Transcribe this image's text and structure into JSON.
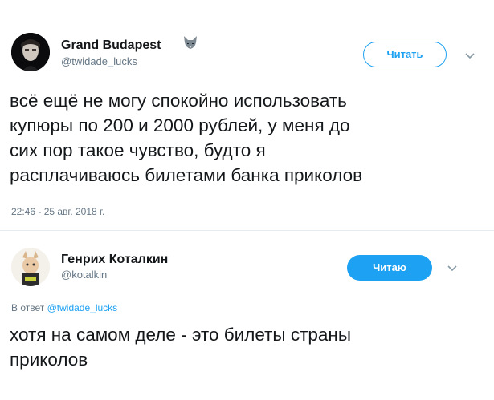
{
  "tweets": [
    {
      "author": {
        "name": "Grand Budapest",
        "handle": "@twidade_lucks",
        "emoji": "wolf-icon"
      },
      "follow_label": "Читать",
      "text_lines": [
        "всё ещё не могу спокойно использовать",
        "купюры по 200 и 2000 рублей, у меня до",
        "сих пор такое чувство, будто я",
        "расплачиваюсь билетами банка приколов"
      ],
      "timestamp": "22:46 - 25 авг. 2018 г."
    },
    {
      "author": {
        "name": "Генрих Коталкин",
        "handle": "@kotalkin"
      },
      "follow_label": "Читаю",
      "reply_prefix": "В ответ",
      "reply_handle": "@twidade_lucks",
      "text_lines": [
        "хотя на самом деле - это билеты страны",
        "приколов"
      ]
    }
  ],
  "colors": {
    "accent": "#1da1f2",
    "text": "#14171a",
    "secondary": "#657786",
    "divider": "#e6ecf0"
  }
}
